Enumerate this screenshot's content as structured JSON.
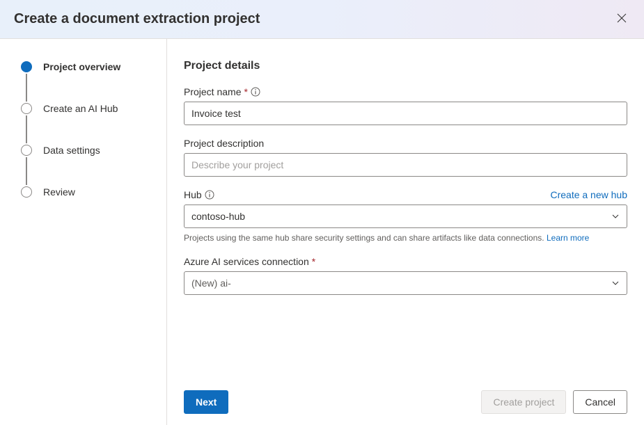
{
  "header": {
    "title": "Create a document extraction project"
  },
  "sidebar": {
    "steps": [
      {
        "label": "Project overview",
        "active": true
      },
      {
        "label": "Create an AI Hub",
        "active": false
      },
      {
        "label": "Data settings",
        "active": false
      },
      {
        "label": "Review",
        "active": false
      }
    ]
  },
  "main": {
    "section_title": "Project details",
    "project_name": {
      "label": "Project name",
      "value": "Invoice test"
    },
    "project_description": {
      "label": "Project description",
      "placeholder": "Describe your project",
      "value": ""
    },
    "hub": {
      "label": "Hub",
      "create_link": "Create a new hub",
      "value": "contoso-hub",
      "helper": "Projects using the same hub share security settings and can share artifacts like data connections.",
      "learn_more": "Learn more"
    },
    "ai_connection": {
      "label": "Azure AI services connection",
      "value": "(New) ai-"
    }
  },
  "footer": {
    "next": "Next",
    "create": "Create project",
    "cancel": "Cancel"
  }
}
